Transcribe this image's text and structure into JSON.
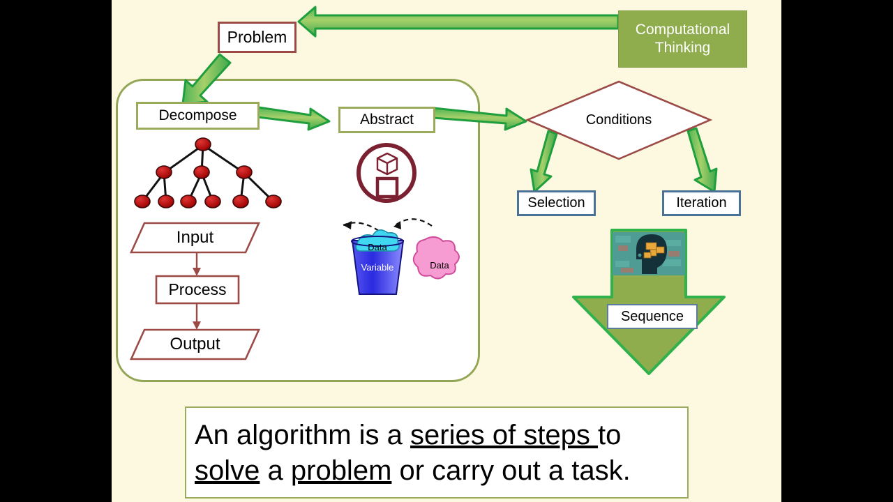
{
  "slide": {
    "background_color": "#FDF9E0",
    "letterbox_color": "#000000"
  },
  "nodes": {
    "computational_thinking": {
      "label_line1": "Computational",
      "label_line2": "Thinking",
      "fill": "#8FAD4C",
      "text_color": "#FFFFFF"
    },
    "problem": {
      "label": "Problem",
      "border": "#9C4A46"
    },
    "decompose": {
      "label": "Decompose",
      "border": "#9BAB5C"
    },
    "abstract": {
      "label": "Abstract",
      "border": "#9BAB5C"
    },
    "conditions": {
      "label": "Conditions",
      "border": "#9C4A46"
    },
    "selection": {
      "label": "Selection",
      "border": "#4A7296"
    },
    "iteration": {
      "label": "Iteration",
      "border": "#4A7296"
    },
    "sequence": {
      "label": "Sequence",
      "border": "#5B7C9D"
    }
  },
  "flowchart": {
    "input": {
      "label": "Input",
      "shape": "parallelogram",
      "color": "#9C4A46"
    },
    "process": {
      "label": "Process",
      "shape": "rectangle",
      "color": "#9C4A46"
    },
    "output": {
      "label": "Output",
      "shape": "parallelogram",
      "color": "#9C4A46"
    }
  },
  "illustrations": {
    "decomposition_tree": {
      "name": "decomposition-tree",
      "node_color": "#C00000",
      "node_count": 10,
      "levels": [
        1,
        3,
        6
      ]
    },
    "abstraction_icon": {
      "name": "abstraction-icon",
      "color": "#7B2030",
      "parts": [
        "circle",
        "cube-3d",
        "square-2d"
      ]
    },
    "variable_data": {
      "bucket_label": "Variable",
      "bucket_contents_label": "Data",
      "blob_label": "Data",
      "bucket_color": "#3838E8",
      "contents_color": "#3FD8F0",
      "blob_color": "#F79BD3"
    },
    "sequence_arrow": {
      "name": "down-arrow-sequence",
      "fill": "#8FAD4C",
      "border": "#2FB24C",
      "thumbnail_name": "head-puzzle-thumbnail"
    }
  },
  "arrows": {
    "accent_border": "#1E9E3C",
    "accent_fill": "#7FC857",
    "list": [
      {
        "name": "ct-to-problem",
        "from": "Computational Thinking",
        "to": "Problem"
      },
      {
        "name": "problem-to-decompose",
        "from": "Problem",
        "to": "Decompose"
      },
      {
        "name": "decompose-to-abstract",
        "from": "Decompose",
        "to": "Abstract"
      },
      {
        "name": "abstract-to-conditions",
        "from": "Abstract",
        "to": "Conditions"
      },
      {
        "name": "conditions-to-selection",
        "from": "Conditions",
        "to": "Selection"
      },
      {
        "name": "conditions-to-iteration",
        "from": "Conditions",
        "to": "Iteration"
      }
    ]
  },
  "statement": {
    "part1": "An algorithm is a ",
    "underline1": "series of steps ",
    "part2": "to ",
    "underline2": "solve",
    "part3": " a ",
    "underline3": "problem",
    "part4": " or carry out a task."
  }
}
